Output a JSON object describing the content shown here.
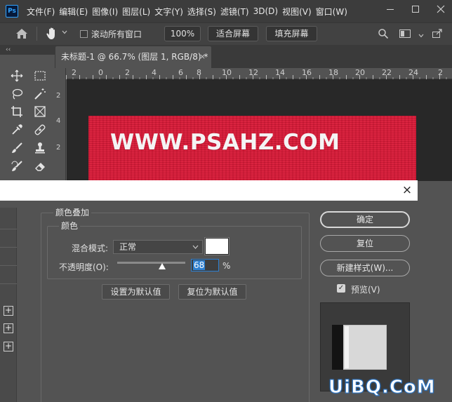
{
  "app": {
    "logo": "Ps"
  },
  "menu": [
    "文件(F)",
    "编辑(E)",
    "图像(I)",
    "图层(L)",
    "文字(Y)",
    "选择(S)",
    "滤镜(T)",
    "3D(D)",
    "视图(V)",
    "窗口(W)"
  ],
  "options_bar": {
    "scroll_all_label": "滚动所有窗口",
    "zoom_value": "100%",
    "fit_screen": "适合屏幕",
    "fill_screen": "填充屏幕"
  },
  "toolbox": {
    "collapse": "‹‹"
  },
  "document_tab": {
    "title": "未标题-1 @ 66.7% (图层 1, RGB/8) *",
    "close": "×"
  },
  "ruler": {
    "top_ticks": [
      "2",
      "0",
      "2",
      "4",
      "6",
      "8",
      "10",
      "12",
      "14",
      "16",
      "18",
      "20",
      "22",
      "24",
      "2"
    ],
    "left_ticks": [
      "2",
      "4",
      "2"
    ]
  },
  "canvas": {
    "text": "WWW.PSAHZ.COM",
    "color": "#d81836"
  },
  "dialog": {
    "close": "×",
    "section_title": "颜色叠加",
    "subsection_title": "颜色",
    "blend_mode_label": "混合模式:",
    "blend_mode_value": "正常",
    "overlay_color": "#ffffff",
    "opacity_label": "不透明度(O):",
    "opacity_value": "68",
    "opacity_unit": "%",
    "set_default": "设置为默认值",
    "reset_default": "复位为默认值",
    "ok": "确定",
    "reset": "复位",
    "new_style": "新建样式(W)...",
    "preview_label": "预览(V)",
    "preview_checked": true,
    "add_symbols": [
      "+",
      "+",
      "+"
    ]
  },
  "watermark": "UiBQ.CoM"
}
